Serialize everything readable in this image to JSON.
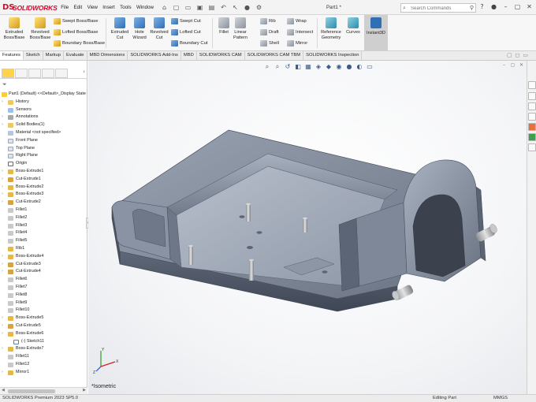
{
  "app": {
    "logo_mark": "DS",
    "brand": "SOLIDWORKS",
    "document_title": "Part1 *",
    "menu": [
      "File",
      "Edit",
      "View",
      "Insert",
      "Tools",
      "Window"
    ],
    "search_placeholder": "Search Commands"
  },
  "ribbon": {
    "big_buttons": [
      {
        "label": "Extruded\nBoss/Base",
        "icon": "extrude-boss-icon"
      },
      {
        "label": "Revolved\nBoss/Base",
        "icon": "revolve-boss-icon"
      },
      {
        "label": "Extruded\nCut",
        "icon": "extrude-cut-icon"
      },
      {
        "label": "Hole\nWizard",
        "icon": "hole-wizard-icon"
      },
      {
        "label": "Revolved\nCut",
        "icon": "revolve-cut-icon"
      },
      {
        "label": "Fillet",
        "icon": "fillet-icon"
      },
      {
        "label": "Linear\nPattern",
        "icon": "linear-pattern-icon"
      },
      {
        "label": "Reference\nGeometry",
        "icon": "reference-geometry-icon"
      },
      {
        "label": "Curves",
        "icon": "curves-icon"
      },
      {
        "label": "Instant3D",
        "icon": "instant3d-icon"
      }
    ],
    "small_buttons": [
      {
        "label": "Swept Boss/Base",
        "icon": "swept-boss-icon"
      },
      {
        "label": "Lofted Boss/Base",
        "icon": "lofted-boss-icon"
      },
      {
        "label": "Boundary Boss/Base",
        "icon": "boundary-boss-icon"
      },
      {
        "label": "Swept Cut",
        "icon": "swept-cut-icon"
      },
      {
        "label": "Lofted Cut",
        "icon": "lofted-cut-icon"
      },
      {
        "label": "Boundary Cut",
        "icon": "boundary-cut-icon"
      },
      {
        "label": "Rib",
        "icon": "rib-icon"
      },
      {
        "label": "Draft",
        "icon": "draft-icon"
      },
      {
        "label": "Shell",
        "icon": "shell-icon"
      },
      {
        "label": "Wrap",
        "icon": "wrap-icon"
      },
      {
        "label": "Intersect",
        "icon": "intersect-icon"
      },
      {
        "label": "Mirror",
        "icon": "mirror-icon"
      }
    ]
  },
  "command_tabs": [
    "Features",
    "Sketch",
    "Markup",
    "Evaluate",
    "MBD Dimensions",
    "SOLIDWORKS Add-Ins",
    "MBD",
    "SOLIDWORKS CAM",
    "SOLIDWORKS CAM TBM",
    "SOLIDWORKS Inspection"
  ],
  "active_tab": "Features",
  "feature_tree": {
    "root": "Part1  (Default) <<Default>_Display State",
    "items": [
      {
        "label": "History",
        "icon": "folder-icon",
        "expand": true
      },
      {
        "label": "Sensors",
        "icon": "sensor-icon",
        "expand": false
      },
      {
        "label": "Annotations",
        "icon": "annotation-icon",
        "expand": true
      },
      {
        "label": "Solid Bodies(1)",
        "icon": "folder-icon",
        "expand": true
      },
      {
        "label": "Material <not specified>",
        "icon": "material-icon",
        "expand": false
      },
      {
        "label": "Front Plane",
        "icon": "plane-icon",
        "expand": false
      },
      {
        "label": "Top Plane",
        "icon": "plane-icon",
        "expand": false
      },
      {
        "label": "Right Plane",
        "icon": "plane-icon",
        "expand": false
      },
      {
        "label": "Origin",
        "icon": "origin-icon",
        "expand": false
      },
      {
        "label": "Boss-Extrude1",
        "icon": "feature-icon",
        "expand": true
      },
      {
        "label": "Cut-Extrude1",
        "icon": "cut-icon",
        "expand": true
      },
      {
        "label": "Boss-Extrude2",
        "icon": "feature-icon",
        "expand": true
      },
      {
        "label": "Boss-Extrude3",
        "icon": "feature-icon",
        "expand": true
      },
      {
        "label": "Cut-Extrude2",
        "icon": "cut-icon",
        "expand": true
      },
      {
        "label": "Fillet1",
        "icon": "fillet-icon",
        "expand": false
      },
      {
        "label": "Fillet2",
        "icon": "fillet-icon",
        "expand": false
      },
      {
        "label": "Fillet3",
        "icon": "fillet-icon",
        "expand": false
      },
      {
        "label": "Fillet4",
        "icon": "fillet-icon",
        "expand": false
      },
      {
        "label": "Fillet5",
        "icon": "fillet-icon",
        "expand": false
      },
      {
        "label": "Rib1",
        "icon": "feature-icon",
        "expand": false
      },
      {
        "label": "Boss-Extrude4",
        "icon": "feature-icon",
        "expand": true
      },
      {
        "label": "Cut-Extrude3",
        "icon": "cut-icon",
        "expand": true
      },
      {
        "label": "Cut-Extrude4",
        "icon": "cut-icon",
        "expand": true
      },
      {
        "label": "Fillet6",
        "icon": "fillet-icon",
        "expand": false
      },
      {
        "label": "Fillet7",
        "icon": "fillet-icon",
        "expand": false
      },
      {
        "label": "Fillet8",
        "icon": "fillet-icon",
        "expand": false
      },
      {
        "label": "Fillet9",
        "icon": "fillet-icon",
        "expand": false
      },
      {
        "label": "Fillet10",
        "icon": "fillet-icon",
        "expand": false
      },
      {
        "label": "Boss-Extrude5",
        "icon": "feature-icon",
        "expand": true
      },
      {
        "label": "Cut-Extrude5",
        "icon": "cut-icon",
        "expand": true
      },
      {
        "label": "Boss-Extrude6",
        "icon": "feature-icon",
        "expand": true
      },
      {
        "label": "(-) Sketch11",
        "icon": "sketch-icon",
        "expand": false,
        "indent": true
      },
      {
        "label": "Boss-Extrude7",
        "icon": "feature-icon",
        "expand": true
      },
      {
        "label": "Fillet11",
        "icon": "fillet-icon",
        "expand": false
      },
      {
        "label": "Fillet12",
        "icon": "fillet-icon",
        "expand": false
      },
      {
        "label": "Mirror1",
        "icon": "feature-icon",
        "expand": true
      }
    ]
  },
  "viewport": {
    "view_label": "*Isometric",
    "triad_labels": {
      "x": "X",
      "y": "Y",
      "z": "Z"
    }
  },
  "status_bar": {
    "app_version": "SOLIDWORKS Premium 2023 SP5.0",
    "mode": "Editing Part",
    "units": "MMGS"
  },
  "colors": {
    "brand_red": "#c8102e",
    "model_steel": "#7d8799",
    "ribbon_bg": "#f7f7f7"
  }
}
